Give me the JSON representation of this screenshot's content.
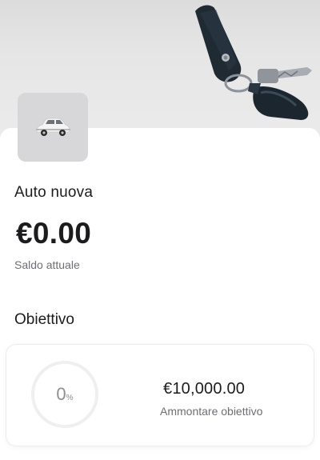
{
  "goal": {
    "name": "Auto nuova",
    "balance": "€0.00",
    "balance_label": "Saldo attuale"
  },
  "objective": {
    "section_title": "Obiettivo",
    "progress_number": "0",
    "progress_unit": "%",
    "progress_fraction": 0,
    "target_amount": "€10,000.00",
    "target_label": "Ammontare obiettivo"
  },
  "icons": {
    "thumbnail": "car-icon",
    "hero": "car-keys-icon"
  }
}
